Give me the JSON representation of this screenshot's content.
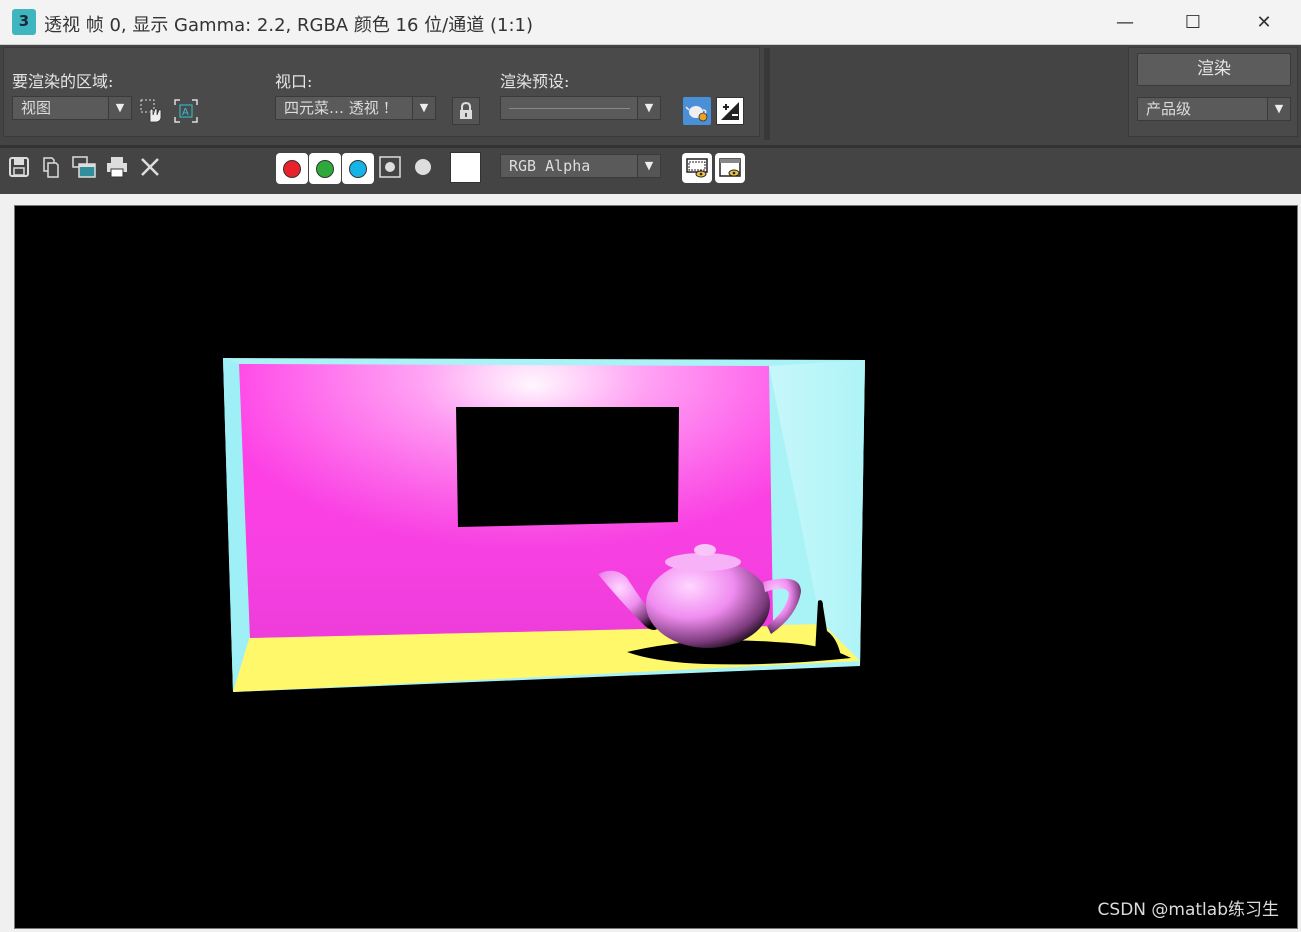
{
  "window": {
    "title": "透视 帧 0, 显示 Gamma: 2.2, RGBA 颜色 16 位/通道 (1:1)",
    "app_icon_text": "3",
    "minimize_glyph": "—",
    "maximize_glyph": "☐",
    "close_glyph": "✕"
  },
  "render_setup": {
    "area_label": "要渲染的区域:",
    "area_value": "视图",
    "viewport_label": "视口:",
    "viewport_value": "四元菜… 透视 !",
    "preset_label": "渲染预设:",
    "preset_value": "",
    "render_button": "渲染",
    "quality_value": "产品级"
  },
  "toolbar2": {
    "channel_display_value": "RGB Alpha",
    "channels": [
      {
        "name": "red",
        "color": "#e8212a"
      },
      {
        "name": "green",
        "color": "#2eaa3b"
      },
      {
        "name": "blue",
        "color": "#16b3e6"
      }
    ]
  },
  "icons": [
    "save-icon",
    "copy-icon",
    "clone-window-icon",
    "print-icon",
    "clear-icon",
    "region-icon",
    "auto-region-icon",
    "lock-icon",
    "teapot-settings-icon",
    "exposure-icon",
    "display-settings-icon",
    "frame-window-icon"
  ],
  "colors": {
    "back_wall": "#ff4de8",
    "floor": "#fff86b",
    "side_wall": "#b8f8fb",
    "teapot": "#f08cf0"
  },
  "watermark": "CSDN @matlab练习生"
}
